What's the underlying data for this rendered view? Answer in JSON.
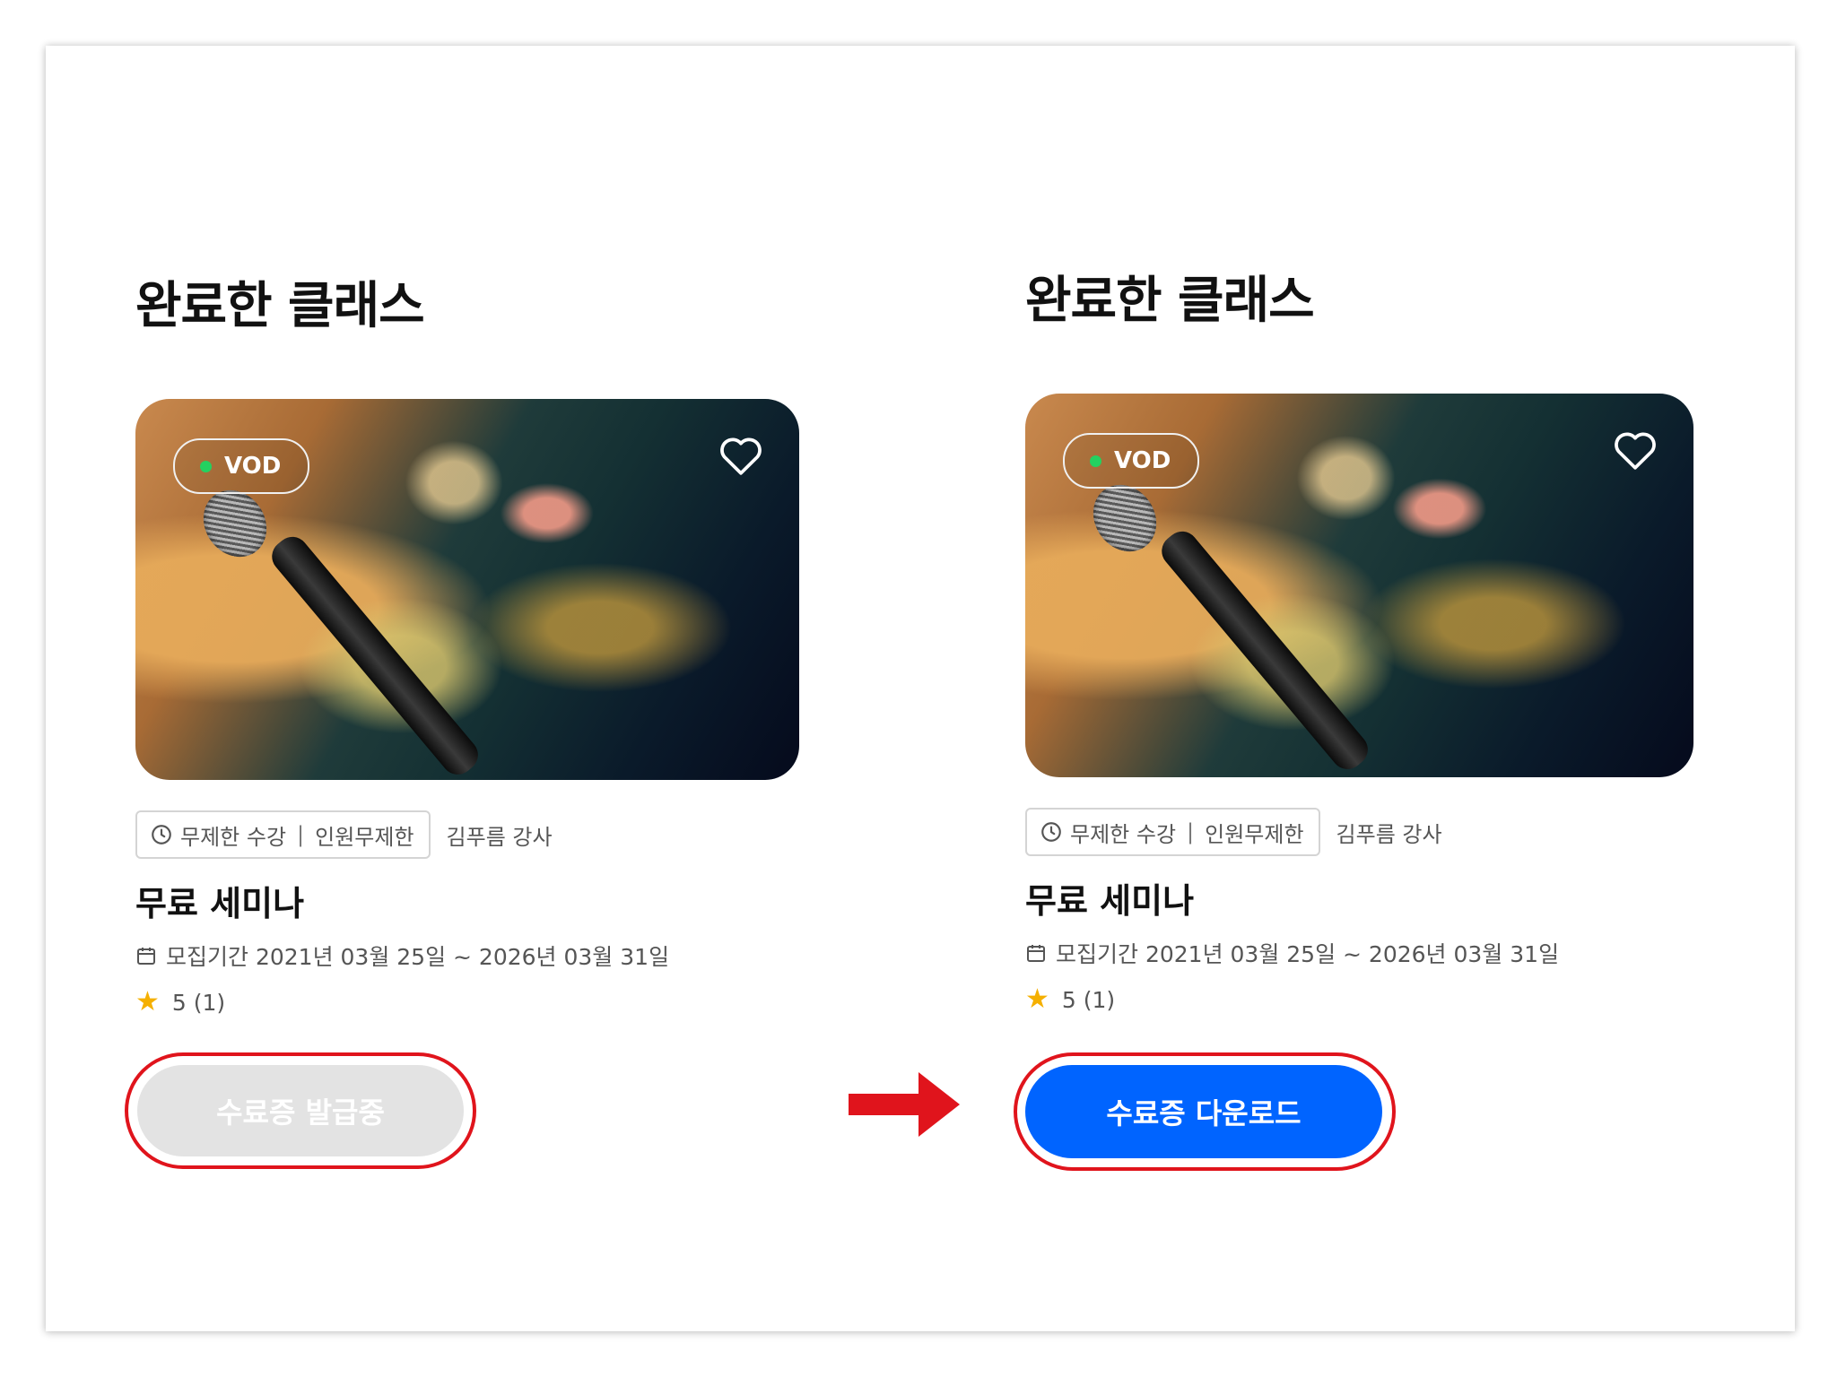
{
  "colors": {
    "primary_button": "#0064ff",
    "disabled_button": "#e3e3e3",
    "highlight_ring": "#e0141c",
    "vod_dot": "#23d160",
    "star": "#f5b000"
  },
  "panels": [
    {
      "section_title": "완료한 클래스",
      "badge": "VOD",
      "tag": {
        "icon": "clock-icon",
        "text1": "무제한 수강",
        "separator": "|",
        "text2": "인원무제한"
      },
      "teacher": "김푸름 강사",
      "class_name": "무료 세미나",
      "period": {
        "icon": "calendar-icon",
        "text": "모집기간 2021년 03월 25일 ~ 2026년 03월 31일"
      },
      "rating": {
        "icon": "star-icon",
        "text": "5 (1)"
      },
      "button": {
        "label": "수료증 발급중",
        "state": "disabled"
      }
    },
    {
      "section_title": "완료한 클래스",
      "badge": "VOD",
      "tag": {
        "icon": "clock-icon",
        "text1": "무제한 수강",
        "separator": "|",
        "text2": "인원무제한"
      },
      "teacher": "김푸름 강사",
      "class_name": "무료 세미나",
      "period": {
        "icon": "calendar-icon",
        "text": "모집기간 2021년 03월 25일 ~ 2026년 03월 31일"
      },
      "rating": {
        "icon": "star-icon",
        "text": "5 (1)"
      },
      "button": {
        "label": "수료증 다운로드",
        "state": "enabled"
      }
    }
  ],
  "annotation": {
    "icon": "arrow-right-icon"
  }
}
